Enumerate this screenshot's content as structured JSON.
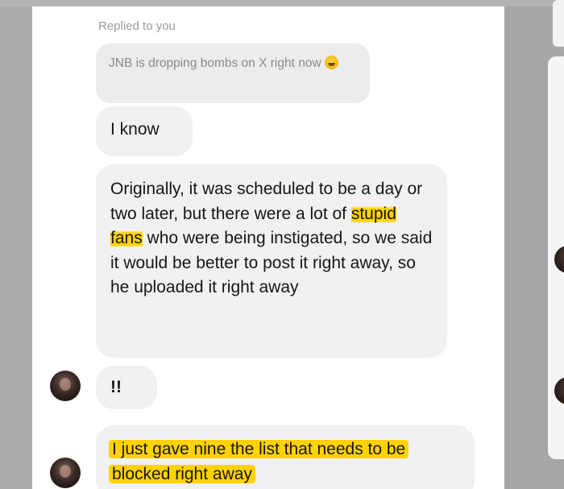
{
  "chat": {
    "reply_label": "Replied to you",
    "replied_message": "JNB is dropping bombs on X right now",
    "replied_emoji": "laughing-tears-emoji",
    "messages": [
      {
        "text": "I know"
      },
      {
        "text_before": "Originally, it was scheduled to be a day or two later, but there were a lot of ",
        "highlight": "stupid fans",
        "text_after": " who were being instigated, so we said it would be better to post it right away, so he uploaded it right away"
      },
      {
        "text": "!!"
      },
      {
        "highlight": "I just gave nine the list that needs to be blocked right away"
      }
    ]
  },
  "colors": {
    "highlight": "#ffd400",
    "bubble_bg": "#f1f1f3",
    "reply_bg": "#ececef",
    "background": "#a6a6a6"
  }
}
